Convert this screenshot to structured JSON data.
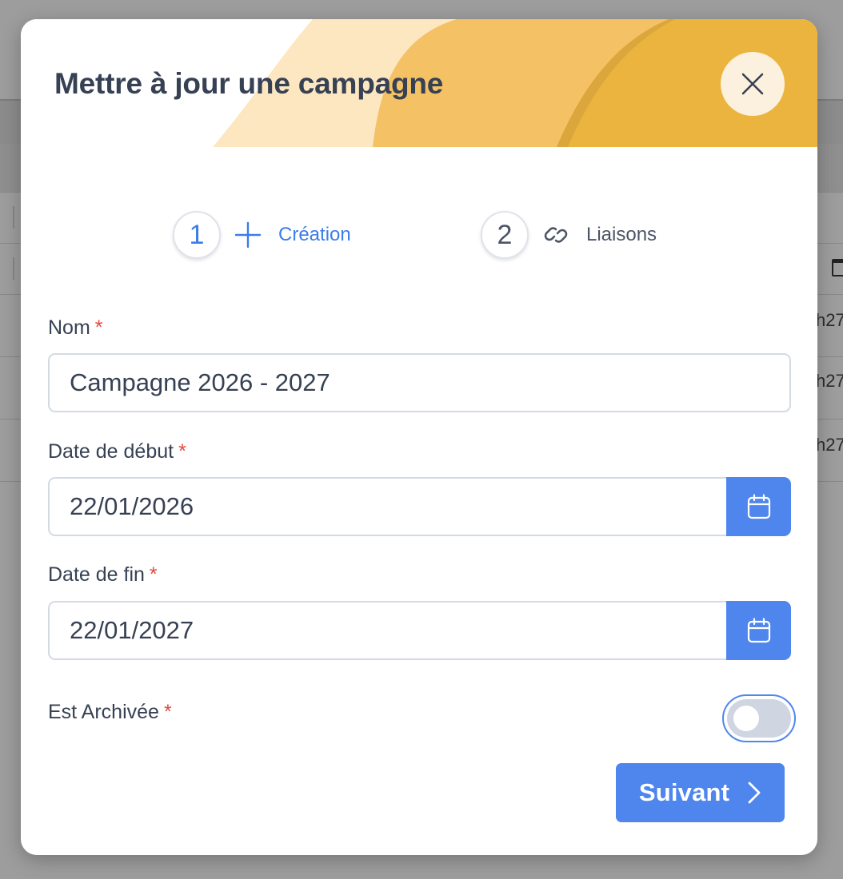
{
  "background": {
    "cell_fragments": [
      "h27",
      "h27",
      "h27"
    ]
  },
  "modal": {
    "title": "Mettre à jour une campagne",
    "close_icon": "close-icon"
  },
  "stepper": {
    "steps": [
      {
        "number": "1",
        "label": "Création",
        "icon": "plus-icon",
        "active": true
      },
      {
        "number": "2",
        "label": "Liaisons",
        "icon": "link-icon",
        "active": false
      }
    ]
  },
  "form": {
    "required_marker": "*",
    "nom": {
      "label": "Nom",
      "value": "Campagne 2026 - 2027"
    },
    "date_debut": {
      "label": "Date de début",
      "value": "22/01/2026",
      "icon": "calendar-icon"
    },
    "date_fin": {
      "label": "Date de fin",
      "value": "22/01/2027",
      "icon": "calendar-icon"
    },
    "est_archivee": {
      "label": "Est Archivée",
      "checked": false
    }
  },
  "actions": {
    "next_label": "Suivant",
    "next_icon": "chevron-right-icon"
  },
  "colors": {
    "accent": "#4f86ee",
    "step_active": "#3b7de8",
    "required": "#e2483d",
    "header_gold": "#ebb43f",
    "text": "#374154"
  }
}
